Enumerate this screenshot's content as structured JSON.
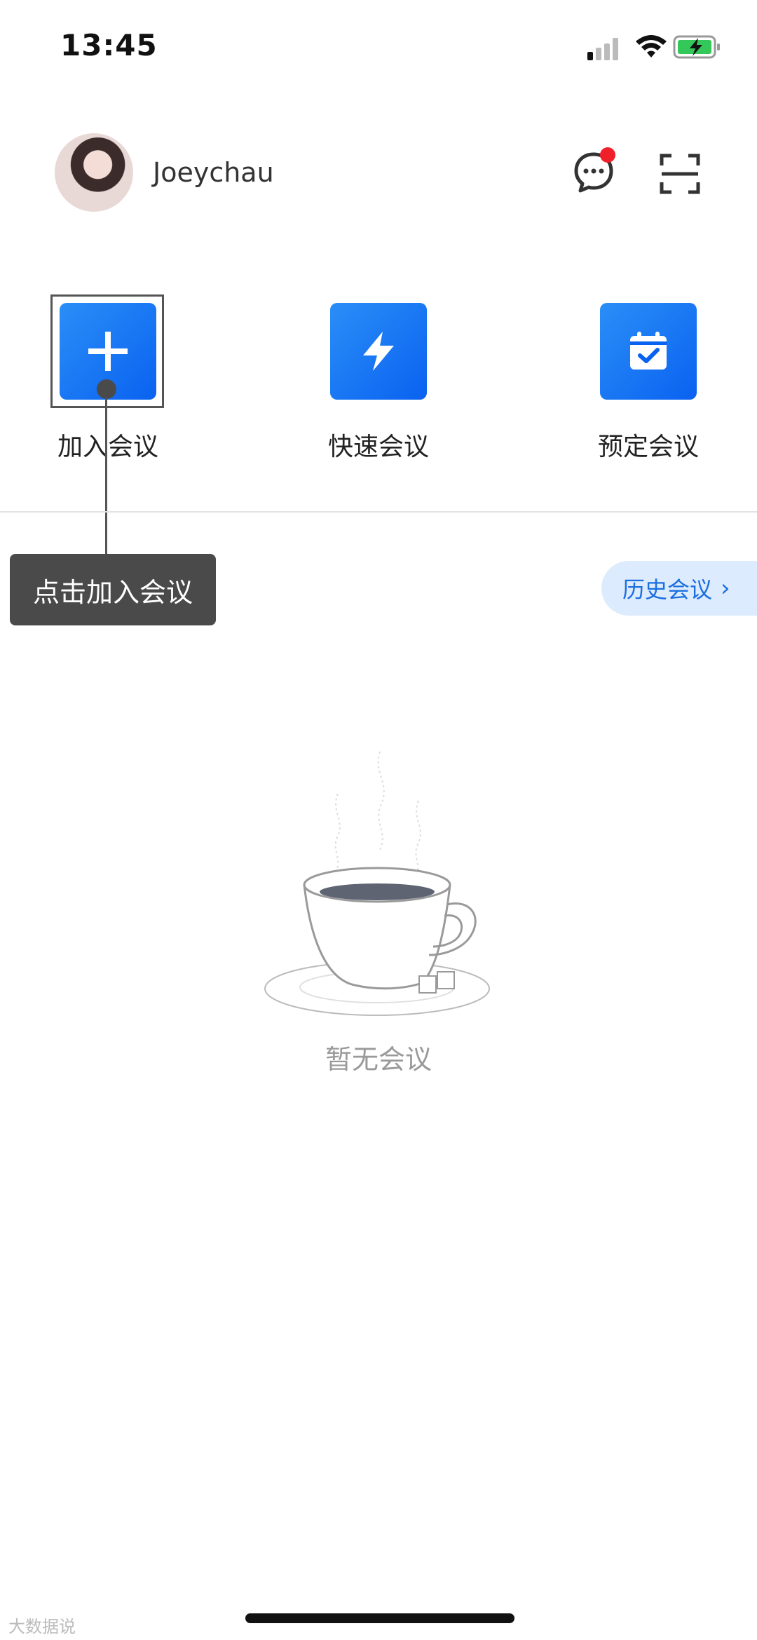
{
  "status_bar": {
    "time": "13:45"
  },
  "header": {
    "username": "Joeychau"
  },
  "actions": [
    {
      "label": "加入会议",
      "icon": "plus-icon"
    },
    {
      "label": "快速会议",
      "icon": "lightning-icon"
    },
    {
      "label": "预定会议",
      "icon": "calendar-check-icon"
    }
  ],
  "guide": {
    "tooltip": "点击加入会议"
  },
  "history": {
    "label": "历史会议"
  },
  "empty": {
    "text": "暂无会议"
  },
  "watermark": "大数据说",
  "colors": {
    "accent": "#0a62f0",
    "badge": "#f0202a",
    "tooltip_bg": "#4a4a4a"
  }
}
